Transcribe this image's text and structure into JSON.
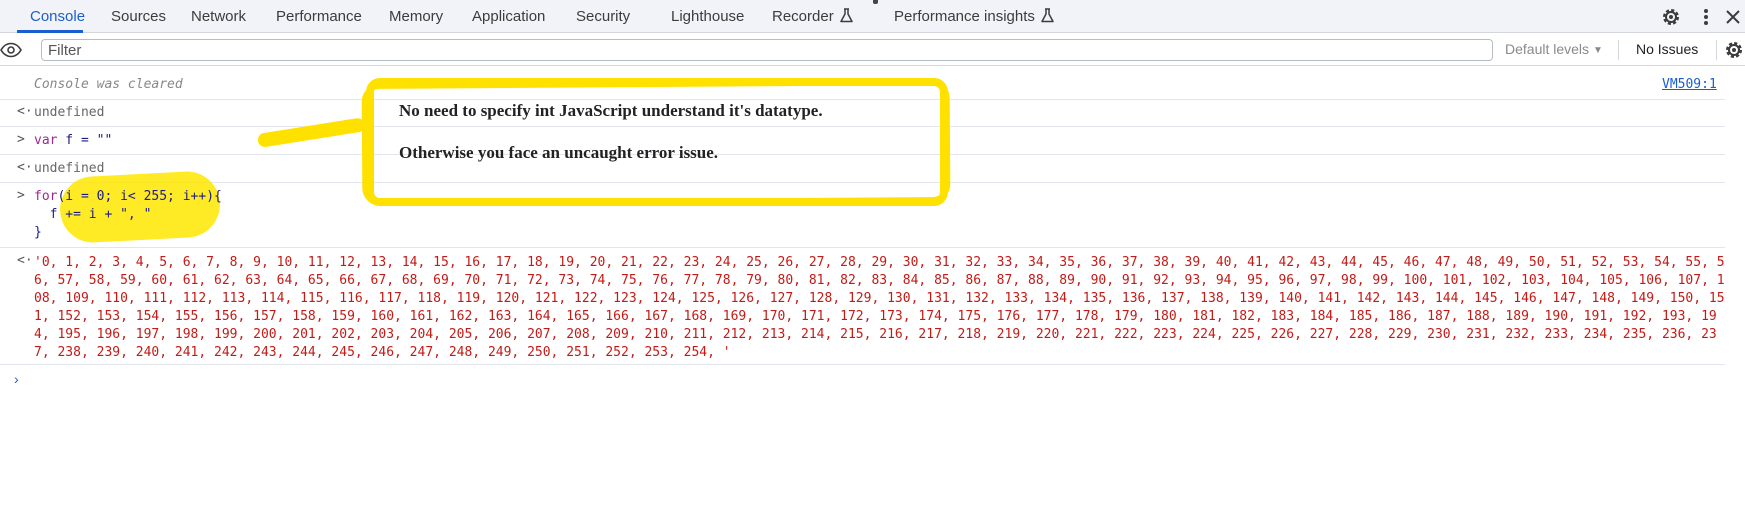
{
  "tabs": {
    "items": [
      "Console",
      "Sources",
      "Network",
      "Performance",
      "Memory",
      "Application",
      "Security",
      "Lighthouse",
      "Recorder",
      "Performance insights"
    ],
    "active": "Console"
  },
  "icons": {
    "flask": "flask-icon",
    "settings": "gear-icon",
    "more": "kebab-menu-icon",
    "close": "close-icon",
    "eye": "eye-icon",
    "prompt": "chevron-right-icon"
  },
  "filter_bar": {
    "filter_placeholder": "Filter",
    "levels_label": "Default levels",
    "issues_label": "No Issues"
  },
  "console": {
    "cleared_text": "Console was cleared",
    "source_link": "VM509:1",
    "undefined_text": "undefined",
    "var_kw": "var",
    "var_rest": " f = \"\"",
    "for_kw": "for",
    "for_rest": "(i = 0; i< 255; i++){",
    "loop_body": "  f += i + \", \"",
    "loop_close": "}",
    "output": "'0, 1, 2, 3, 4, 5, 6, 7, 8, 9, 10, 11, 12, 13, 14, 15, 16, 17, 18, 19, 20, 21, 22, 23, 24, 25, 26, 27, 28, 29, 30, 31, 32, 33, 34, 35, 36, 37, 38, 39, 40, 41, 42, 43, 44, 45, 46, 47, 48, 49, 50, 51, 52, 53, 54, 55, 56, 57, 58, 59, 60, 61, 62, 63, 64, 65, 66, 67, 68, 69, 70, 71, 72, 73, 74, 75, 76, 77, 78, 79, 80, 81, 82, 83, 84, 85, 86, 87, 88, 89, 90, 91, 92, 93, 94, 95, 96, 97, 98, 99, 100, 101, 102, 103, 104, 105, 106, 107, 108, 109, 110, 111, 112, 113, 114, 115, 116, 117, 118, 119, 120, 121, 122, 123, 124, 125, 126, 127, 128, 129, 130, 131, 132, 133, 134, 135, 136, 137, 138, 139, 140, 141, 142, 143, 144, 145, 146, 147, 148, 149, 150, 151, 152, 153, 154, 155, 156, 157, 158, 159, 160, 161, 162, 163, 164, 165, 166, 167, 168, 169, 170, 171, 172, 173, 174, 175, 176, 177, 178, 179, 180, 181, 182, 183, 184, 185, 186, 187, 188, 189, 190, 191, 192, 193, 194, 195, 196, 197, 198, 199, 200, 201, 202, 203, 204, 205, 206, 207, 208, 209, 210, 211, 212, 213, 214, 215, 216, 217, 218, 219, 220, 221, 222, 223, 224, 225, 226, 227, 228, 229, 230, 231, 232, 233, 234, 235, 236, 237, 238, 239, 240, 241, 242, 243, 244, 245, 246, 247, 248, 249, 250, 251, 252, 253, 254, '"
  },
  "annotation": {
    "line1": "No need to specify int JavaScript understand it's datatype.",
    "line2": "Otherwise you face an uncaught error issue."
  },
  "colors": {
    "accent": "#1a5fd0",
    "string_red": "#c41a16",
    "keyword_purple": "#a02890",
    "highlight_yellow": "#ffe100"
  }
}
